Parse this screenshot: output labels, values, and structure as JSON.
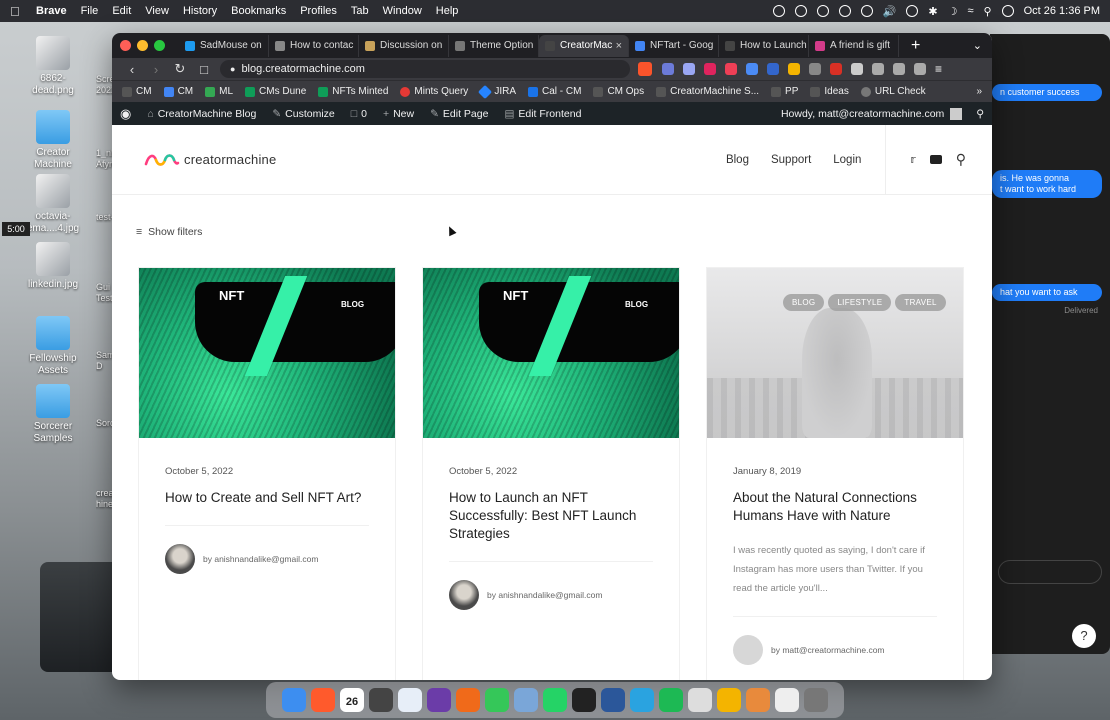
{
  "menubar": {
    "app": "Brave",
    "items": [
      "File",
      "Edit",
      "View",
      "History",
      "Bookmarks",
      "Profiles",
      "Tab",
      "Window",
      "Help"
    ],
    "clock": "Oct 26  1:36 PM"
  },
  "desktop": {
    "icons": [
      {
        "label": "6862-\ndead.png"
      },
      {
        "label": "Creator\nMachine"
      },
      {
        "label": "octavia-\nema....4.jpg"
      },
      {
        "label": "linkedin.jpg"
      },
      {
        "label": "Fellowship\nAssets"
      },
      {
        "label": "Sorcerer\nSamples"
      }
    ],
    "partial_labels": [
      "Scre",
      "2022",
      "1_nK",
      "Afym",
      "test-",
      "Gui",
      "Test",
      "Samp",
      "D",
      "Sorc",
      "creat",
      "hine."
    ],
    "timer": "5:00"
  },
  "messages": {
    "bubbles": [
      "n customer success",
      "is. He was gonna\nt want to work hard",
      "hat you want to ask"
    ],
    "delivered": "Delivered"
  },
  "browser": {
    "tabs": [
      {
        "label": "SadMouse on",
        "color": "#1d9bf0"
      },
      {
        "label": "How to contac",
        "color": "#888"
      },
      {
        "label": "Discussion on",
        "color": "#c8a25a"
      },
      {
        "label": "Theme Option",
        "color": "#777"
      },
      {
        "label": "CreatorMac",
        "color": "#444",
        "active": true
      },
      {
        "label": "NFTart - Goog",
        "color": "#4285f4"
      },
      {
        "label": "How to Launch",
        "color": "#444"
      },
      {
        "label": "A friend is gift",
        "color": "#d43b8a"
      }
    ],
    "url": "blog.creatormachine.com",
    "bookmarks": [
      "CM",
      "CM",
      "ML",
      "CMs Dune",
      "NFTs Minted",
      "Mints Query",
      "JIRA",
      "Cal - CM",
      "CM Ops",
      "CreatorMachine S...",
      "PP",
      "Ideas",
      "URL Check"
    ]
  },
  "wpbar": {
    "site_name": "CreatorMachine Blog",
    "customize": "Customize",
    "comments": "0",
    "new": "New",
    "edit_page": "Edit Page",
    "edit_frontend": "Edit Frontend",
    "howdy": "Howdy, matt@creatormachine.com"
  },
  "site": {
    "logo_text": "creatormachine",
    "nav": [
      "Blog",
      "Support",
      "Login"
    ],
    "show_filters": "Show filters"
  },
  "posts": [
    {
      "date": "October 5, 2022",
      "title": "How to Create and Sell NFT Art?",
      "author": "by anishnandalike@gmail.com",
      "image": {
        "nft_text": "NFT",
        "blog_text": "BLOG"
      }
    },
    {
      "date": "October 5, 2022",
      "title": "How to Launch an NFT Successfully: Best NFT Launch Strategies",
      "author": "by anishnandalike@gmail.com",
      "image": {
        "nft_text": "NFT",
        "blog_text": "BLOG"
      }
    },
    {
      "date": "January 8, 2019",
      "title": "About the Natural Connections Humans Have with Nature",
      "excerpt": "I was recently quoted as saying, I don't care if Instagram has more users than Twitter. If you read the article you'll...",
      "author": "by matt@creatormachine.com",
      "tags": [
        "BLOG",
        "LIFESTYLE",
        "TRAVEL"
      ]
    }
  ],
  "dock": {
    "calendar_day": "26",
    "icon_colors": [
      "#3d8ef0",
      "#ff5a2c",
      "#ffffff",
      "#444444",
      "#e7eef8",
      "#6b3ca8",
      "#f06a1a",
      "#35c759",
      "#7aa6d8",
      "#25d366",
      "#222222",
      "#2b579a",
      "#2aa3e0",
      "#1db954",
      "#dddddd",
      "#f4b400",
      "#e88a3c",
      "#eeeeee",
      "#777777"
    ]
  },
  "colors": {
    "wp_admin": "#1d2327",
    "nft_green": "#36f0a8",
    "browser_chrome": "#3a3a3f"
  }
}
